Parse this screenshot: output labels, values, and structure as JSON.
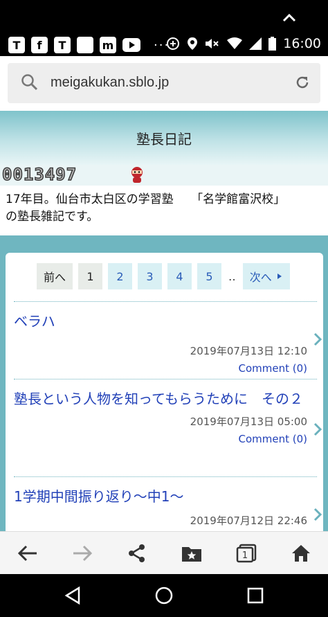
{
  "status_bar": {
    "time": "16:00",
    "apps": [
      "T",
      "f",
      "T",
      "",
      "m",
      ""
    ],
    "overflow": "···"
  },
  "address_bar": {
    "url": "meigakukan.sblo.jp"
  },
  "site": {
    "title": "塾長日記",
    "counter": "0013497",
    "description_line1": "17年目。仙台市太白区の学習塾　　「名学館富沢校」",
    "description_line2": "の塾長雑記です。"
  },
  "pager": {
    "prev": "前へ",
    "pages": [
      "1",
      "2",
      "3",
      "4",
      "5"
    ],
    "dots": "‥",
    "next": "次へ"
  },
  "entries": [
    {
      "title": "ベラハ",
      "date": "2019年07月13日 12:10",
      "comment": "Comment (0)"
    },
    {
      "title": "塾長という人物を知ってもらうために　その２",
      "date": "2019年07月13日 05:00",
      "comment": "Comment (0)"
    },
    {
      "title": "1学期中間振り返り～中1～",
      "date": "2019年07月12日 22:46",
      "comment": ""
    }
  ],
  "colors": {
    "accent": "#6fb6c0",
    "link": "#2241b8"
  }
}
